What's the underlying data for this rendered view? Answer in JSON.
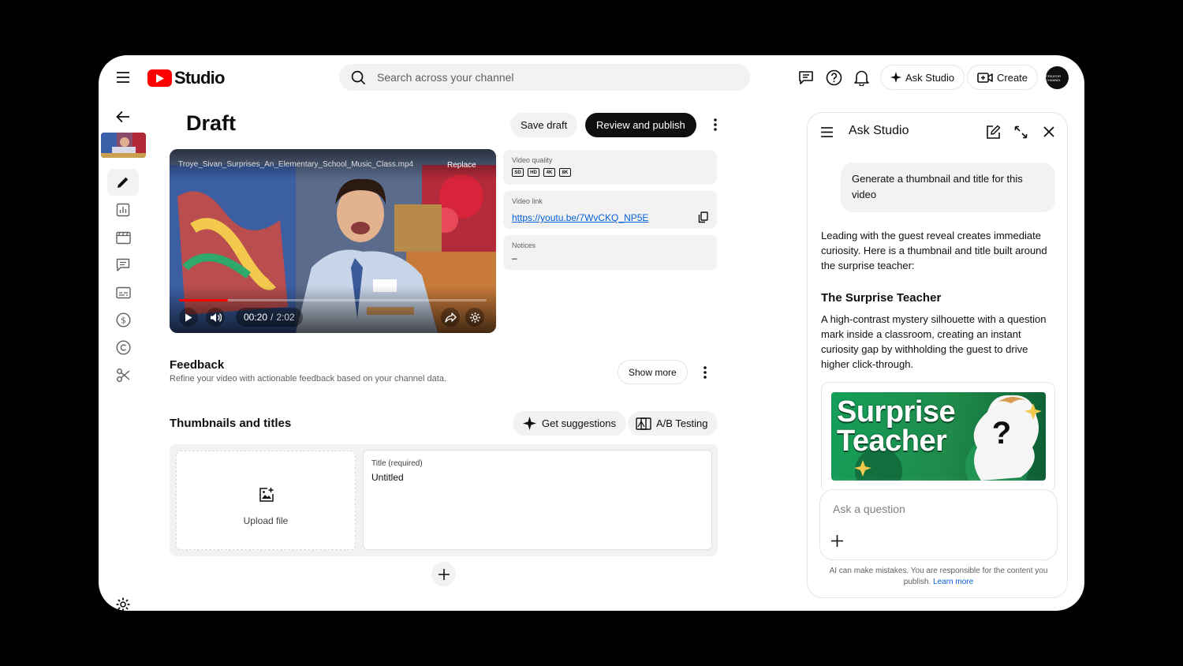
{
  "app": {
    "logo_text": "Studio"
  },
  "search": {
    "placeholder": "Search across your channel"
  },
  "header": {
    "ask_studio_label": "Ask Studio",
    "create_label": "Create",
    "avatar_text": "CREATOR CHANNEL"
  },
  "page": {
    "title": "Draft",
    "save_draft_label": "Save draft",
    "review_publish_label": "Review and publish"
  },
  "player": {
    "filename": "Troye_Sivan_Surprises_An_Elementary_School_Music_Class.mp4",
    "replace_label": "Replace",
    "current_time": "00:20",
    "duration": "2:02",
    "progress": 0.16
  },
  "details": {
    "video_quality_label": "Video quality",
    "qualities": [
      "SD",
      "HD",
      "4K",
      "8K"
    ],
    "video_link_label": "Video link",
    "video_link": "https://youtu.be/7WvCKQ_NP5E",
    "notices_label": "Notices",
    "notices_value": "–"
  },
  "feedback": {
    "title": "Feedback",
    "subtitle": "Refine your video with actionable feedback based on your channel data.",
    "show_more_label": "Show more"
  },
  "thumbnails": {
    "title": "Thumbnails and titles",
    "get_suggestions_label": "Get suggestions",
    "ab_testing_label": "A/B Testing",
    "upload_label": "Upload file",
    "title_field_label": "Title (required)",
    "title_value": "Untitled"
  },
  "ask_studio": {
    "title": "Ask Studio",
    "user_message": "Generate a thumbnail and title for this video",
    "response_intro": "Leading with the guest reveal creates immediate curiosity. Here is a thumbnail and title built around the surprise teacher:",
    "concept_title": "The Surprise Teacher",
    "concept_desc": "A high-contrast mystery silhouette with a question mark inside a classroom, creating an instant curiosity gap by withholding the guest to drive higher click-through.",
    "thumb_line1": "Surprise",
    "thumb_line2": "Teacher",
    "thumb_mark": "?",
    "ask_placeholder": "Ask a question",
    "disclaimer": "AI can make mistakes. You are responsible for the content you publish.",
    "learn_more": "Learn more"
  },
  "colors": {
    "brand_red": "#ff0000",
    "link_blue": "#065fd4",
    "dark": "#0f0f0f",
    "surface": "#f2f2f2"
  }
}
